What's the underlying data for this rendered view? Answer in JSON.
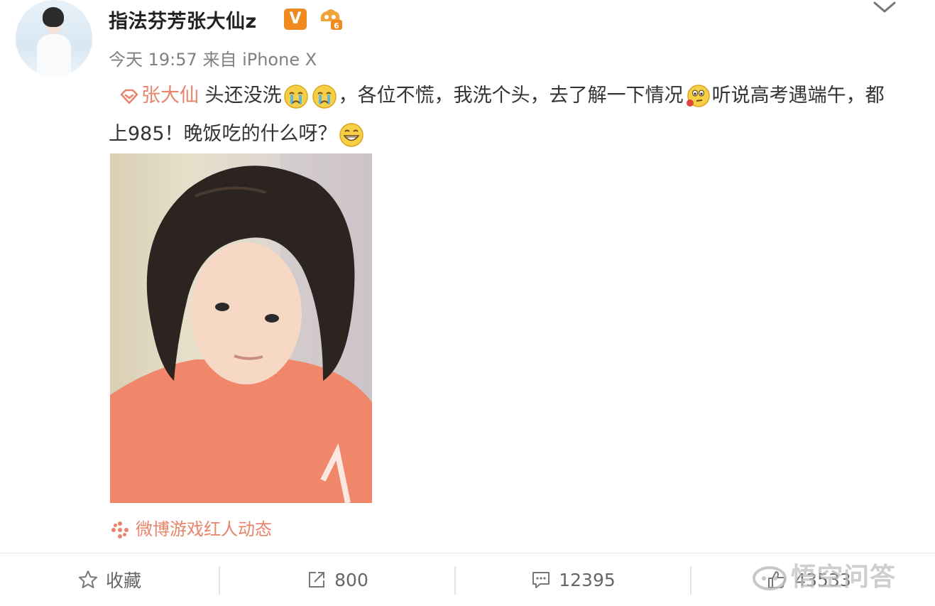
{
  "header": {
    "username": "指法芬芳张大仙z",
    "verified_badge": "V",
    "time": "今天 19:57",
    "source_label": "来自",
    "device": "iPhone X",
    "icons": [
      "avatar",
      "verified-badge-icon",
      "level-badge-icon",
      "chevron-down-icon"
    ]
  },
  "post": {
    "mention": "张大仙",
    "segment1": "头还没洗",
    "segment2": "，各位不慌，我洗个头，去了解一下情况",
    "segment3": "听说高考遇端午，都上985！晚饭吃的什么呀？",
    "emojis": [
      "crying-emoji",
      "crying-emoji",
      "thinking-emoji",
      "grin-emoji"
    ]
  },
  "source_tag": "微博游戏红人动态",
  "actions": [
    {
      "name": "favorite",
      "icon": "star-icon",
      "label": "收藏"
    },
    {
      "name": "repost",
      "icon": "share-icon",
      "label": "800"
    },
    {
      "name": "comment",
      "icon": "comment-icon",
      "label": "12395"
    },
    {
      "name": "like",
      "icon": "thumb-up-icon",
      "label": "43533"
    }
  ],
  "watermark": "悟空问答",
  "colors": {
    "accent": "#e8846b",
    "badge": "#f08a1f",
    "text": "#333333",
    "meta": "#808080"
  }
}
